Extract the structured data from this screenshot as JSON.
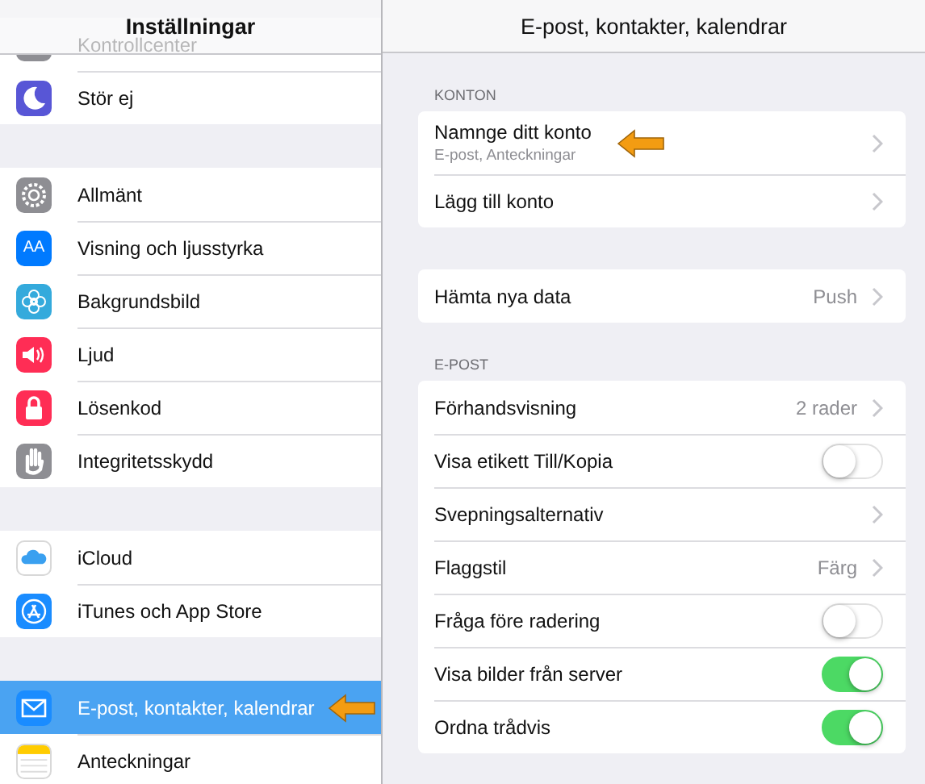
{
  "sidebar": {
    "title": "Inställningar",
    "groups": [
      {
        "items": [
          {
            "label": "Kontrollcenter",
            "color": "#8e8e93",
            "selected": false,
            "pointer_arrow": false
          },
          {
            "label": "Stör ej",
            "color": "#5856d6",
            "selected": false,
            "pointer_arrow": false
          }
        ]
      },
      {
        "items": [
          {
            "label": "Allmänt",
            "color": "#8e8e93",
            "selected": false,
            "pointer_arrow": false
          },
          {
            "label": "Visning och ljusstyrka",
            "color": "#007aff",
            "icon_text": "AA",
            "selected": false,
            "pointer_arrow": false
          },
          {
            "label": "Bakgrundsbild",
            "color": "#34aadc",
            "selected": false,
            "pointer_arrow": false
          },
          {
            "label": "Ljud",
            "color": "#ff2d55",
            "selected": false,
            "pointer_arrow": false
          },
          {
            "label": "Lösenkod",
            "color": "#ff2d55",
            "selected": false,
            "pointer_arrow": false
          },
          {
            "label": "Integritetsskydd",
            "color": "#8e8e93",
            "selected": false,
            "pointer_arrow": false
          }
        ]
      },
      {
        "items": [
          {
            "label": "iCloud",
            "color": "#ffffff",
            "selected": false,
            "pointer_arrow": false
          },
          {
            "label": "iTunes och App Store",
            "color": "#1a8cff",
            "selected": false,
            "pointer_arrow": false
          }
        ]
      },
      {
        "items": [
          {
            "label": "E-post, kontakter, kalendrar",
            "color": "#1a8cff",
            "selected": true,
            "pointer_arrow": true
          },
          {
            "label": "Anteckningar",
            "color": "#ffffff",
            "selected": false,
            "pointer_arrow": false
          }
        ]
      }
    ]
  },
  "detail": {
    "title": "E-post, kontakter, kalendrar",
    "sections": [
      {
        "header": "KONTON",
        "rows": [
          {
            "kind": "link",
            "label": "Namnge ditt konto",
            "subtitle": "E-post, Anteckningar",
            "pointer_arrow": true
          },
          {
            "kind": "link",
            "label": "Lägg till konto",
            "pointer_arrow": false
          }
        ]
      },
      {
        "rows": [
          {
            "kind": "link",
            "label": "Hämta nya data",
            "value": "Push",
            "pointer_arrow": false
          }
        ]
      },
      {
        "header": "E-POST",
        "rows": [
          {
            "kind": "link",
            "label": "Förhandsvisning",
            "value": "2 rader",
            "pointer_arrow": false
          },
          {
            "kind": "toggle",
            "label": "Visa etikett Till/Kopia",
            "on": false,
            "pointer_arrow": false
          },
          {
            "kind": "link",
            "label": "Svepningsalternativ",
            "pointer_arrow": false
          },
          {
            "kind": "link",
            "label": "Flaggstil",
            "value": "Färg",
            "pointer_arrow": false
          },
          {
            "kind": "toggle",
            "label": "Fråga före radering",
            "on": false,
            "pointer_arrow": false
          },
          {
            "kind": "toggle",
            "label": "Visa bilder från server",
            "on": true,
            "pointer_arrow": false
          },
          {
            "kind": "toggle",
            "label": "Ordna trådvis",
            "on": true,
            "pointer_arrow": false
          }
        ]
      }
    ]
  }
}
